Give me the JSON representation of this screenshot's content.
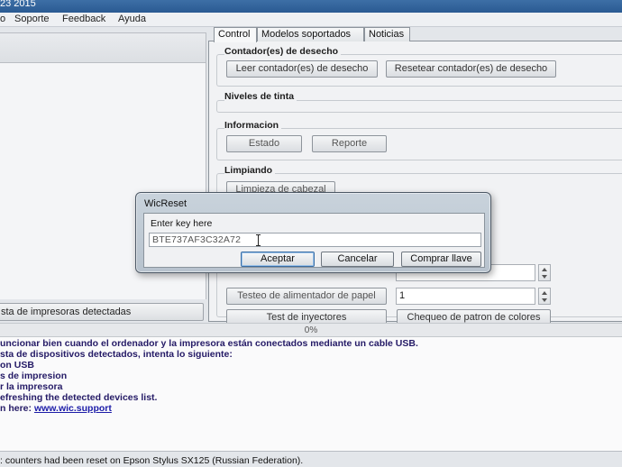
{
  "window": {
    "title_fragment": "23 2015"
  },
  "menu": [
    {
      "label": "o"
    },
    {
      "label": "Soporte"
    },
    {
      "label": "Feedback"
    },
    {
      "label": "Ayuda"
    }
  ],
  "left_pane": {
    "refresh_button": "sta de impresoras detectadas"
  },
  "tabs": [
    {
      "label": "Control",
      "active": true
    },
    {
      "label": "Modelos soportados",
      "active": false
    },
    {
      "label": "Noticias",
      "active": false
    }
  ],
  "control_tab": {
    "waste_counters": {
      "title": "Contador(es) de desecho",
      "read_button": "Leer contador(es) de desecho",
      "reset_button": "Resetear contador(es) de desecho"
    },
    "ink_levels": {
      "title": "Niveles de tinta"
    },
    "information": {
      "title": "Informacion",
      "status_button": "Estado",
      "report_button": "Reporte"
    },
    "cleaning": {
      "title": "Limpiando",
      "head_clean_button": "Limpieza de cabezal",
      "paper_feed_test_button": "Testeo de alimentador de papel",
      "paper_feed_value": "1",
      "nozzle_test_button": "Test de inyectores",
      "color_pattern_button": "Chequeo de patron de colores"
    }
  },
  "progress": {
    "text": "0%",
    "value": 0
  },
  "log_lines": [
    "uncionar bien cuando el ordenador y la impresora están conectados mediante un cable USB.",
    "sta de dispositivos detectados, intenta lo siguiente:",
    "on USB",
    "s de impresion",
    "r la impresora",
    "efreshing the detected devices list.",
    "n here: "
  ],
  "log_link": "www.wic.support",
  "status_bar": ": counters had been reset on Epson Stylus SX125 (Russian Federation).",
  "dialog": {
    "title": "WicReset",
    "prompt": "Enter key here",
    "key_value": "BTE737AF3C32A72",
    "accept_button": "Aceptar",
    "cancel_button": "Cancelar",
    "buy_button": "Comprar llave"
  },
  "colors": {
    "log_text": "#241a66",
    "link": "#1c1ca8",
    "title_bar": "#2a5a92",
    "dialog_frame": "#b7c2cd"
  }
}
